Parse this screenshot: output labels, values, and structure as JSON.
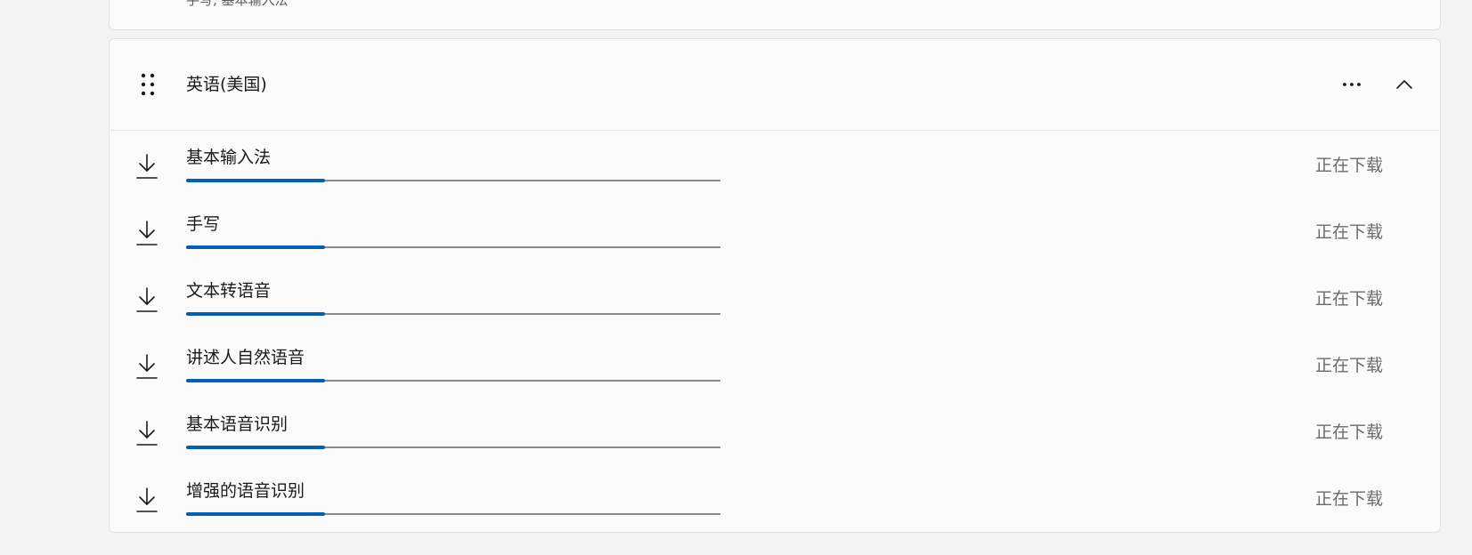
{
  "previous_card": {
    "partial_text": "手写, 基本输入法"
  },
  "language": {
    "name": "英语(美国)",
    "more_icon": "more-horizontal-icon",
    "collapse_icon": "chevron-up-icon",
    "drag_icon": "drag-handle-icon"
  },
  "features": [
    {
      "name": "基本输入法",
      "status": "正在下载",
      "progress": 0.26,
      "icon": "download-icon"
    },
    {
      "name": "手写",
      "status": "正在下载",
      "progress": 0.26,
      "icon": "download-icon"
    },
    {
      "name": "文本转语音",
      "status": "正在下载",
      "progress": 0.26,
      "icon": "download-icon"
    },
    {
      "name": "讲述人自然语音",
      "status": "正在下载",
      "progress": 0.26,
      "icon": "download-icon"
    },
    {
      "name": "基本语音识别",
      "status": "正在下载",
      "progress": 0.26,
      "icon": "download-icon"
    },
    {
      "name": "增强的语音识别",
      "status": "正在下载",
      "progress": 0.26,
      "icon": "download-icon"
    }
  ],
  "colors": {
    "accent": "#005fb8",
    "track": "#8a8a8a",
    "status_text": "#6b6b6b"
  }
}
